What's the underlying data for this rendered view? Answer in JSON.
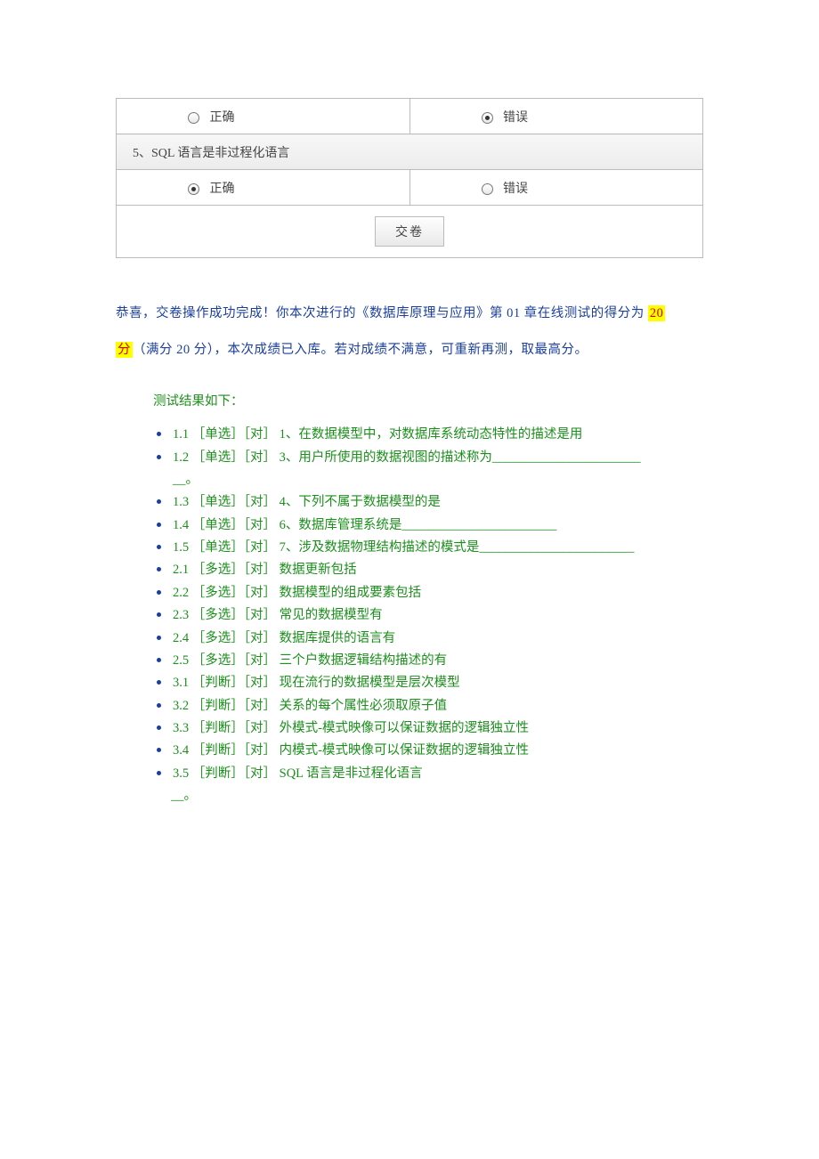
{
  "quiz": {
    "row1": {
      "opt_a_label": "正确",
      "opt_a_selected": false,
      "opt_b_label": "错误",
      "opt_b_selected": true
    },
    "q5_text": "5、SQL 语言是非过程化语言",
    "row2": {
      "opt_a_label": "正确",
      "opt_a_selected": true,
      "opt_b_label": "错误",
      "opt_b_selected": false
    },
    "submit_label": "交卷"
  },
  "congrats": {
    "prefix": "恭喜，交卷操作成功完成！你本次进行的《数据库原理与应用》第 01 章在线测试的得分为 ",
    "score": "20",
    "unit": "分",
    "suffix": "（满分 20 分），本次成绩已入库。若对成绩不满意，可重新再测，取最高分。"
  },
  "results_header": "测试结果如下：",
  "results": [
    "1.1 ［单选］［对］ 1、在数据模型中，对数据库系统动态特性的描述是用",
    "1.2 ［单选］［对］ 3、用户所使用的数据视图的描述称为_______________________",
    "__。",
    "1.3 ［单选］［对］ 4、下列不属于数据模型的是",
    "1.4 ［单选］［对］ 6、数据库管理系统是________________________",
    "1.5 ［单选］［对］ 7、涉及数据物理结构描述的模式是________________________",
    "2.1 ［多选］［对］ 数据更新包括",
    "2.2 ［多选］［对］ 数据模型的组成要素包括",
    "2.3 ［多选］［对］ 常见的数据模型有",
    "2.4 ［多选］［对］ 数据库提供的语言有",
    "2.5 ［多选］［对］ 三个户数据逻辑结构描述的有",
    "3.1 ［判断］［对］ 现在流行的数据模型是层次模型",
    "3.2 ［判断］［对］ 关系的每个属性必须取原子值",
    "3.3 ［判断］［对］ 外模式-模式映像可以保证数据的逻辑独立性",
    "3.4 ［判断］［对］ 内模式-模式映像可以保证数据的逻辑独立性",
    "3.5 ［判断］［对］ SQL 语言是非过程化语言"
  ]
}
